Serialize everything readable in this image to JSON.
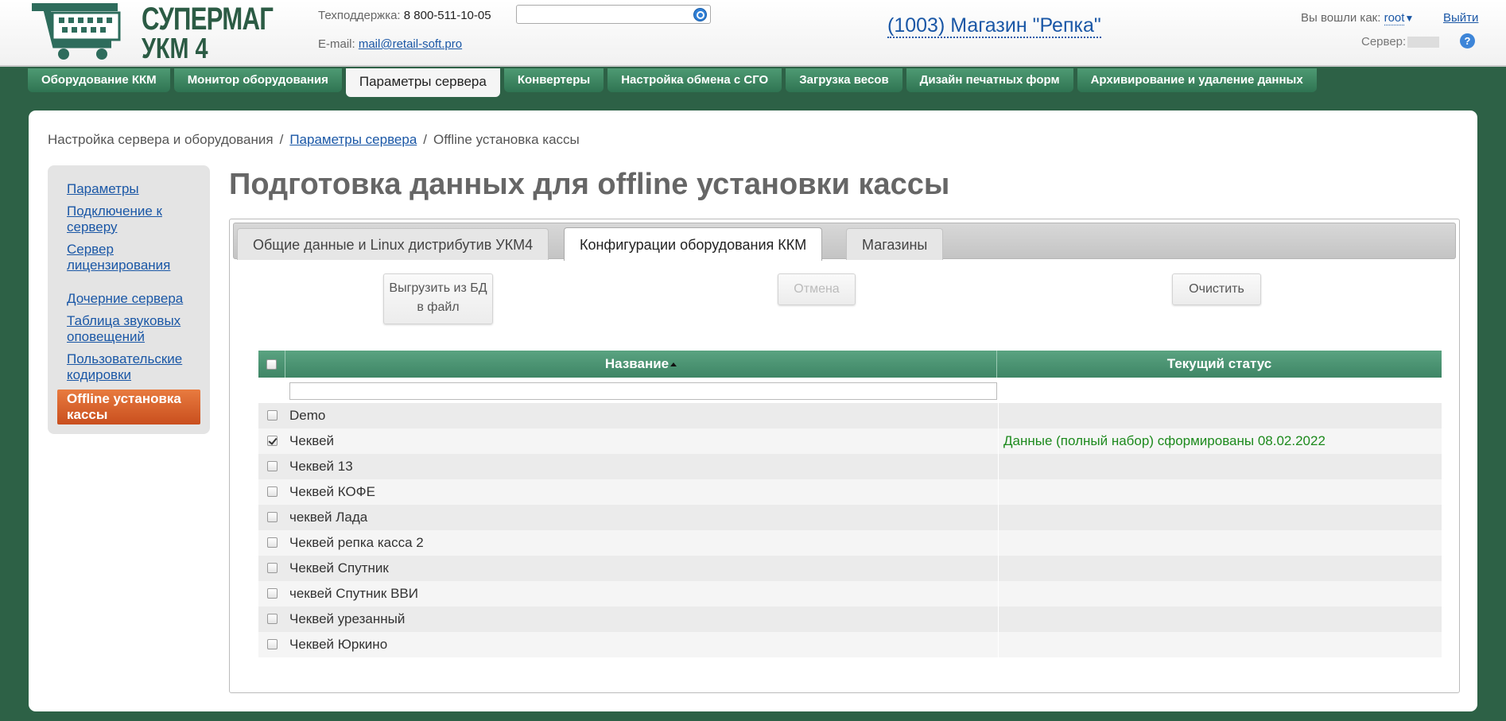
{
  "header": {
    "logo_line1": "СУПЕРМАГ",
    "logo_line2": "УКМ 4",
    "support_label": "Техподдержка:",
    "support_phone": "8 800-511-10-05",
    "email_label": "E-mail:",
    "email": "mail@retail-soft.pro",
    "search_placeholder": "",
    "store_name": "(1003) Магазин \"Репка\"",
    "login_label": "Вы вошли как:",
    "user": "root",
    "logout": "Выйти",
    "server_label": "Сервер:",
    "help": "?"
  },
  "nav": {
    "tabs": [
      {
        "label": "Оборудование ККМ"
      },
      {
        "label": "Монитор оборудования"
      },
      {
        "label": "Параметры сервера"
      },
      {
        "label": "Конвертеры"
      },
      {
        "label": "Настройка обмена с СГО"
      },
      {
        "label": "Загрузка весов"
      },
      {
        "label": "Дизайн печатных форм"
      },
      {
        "label": "Архивирование и удаление данных"
      }
    ],
    "active_index": 2
  },
  "breadcrumb": {
    "root": "Настройка сервера и оборудования",
    "parent": "Параметры сервера",
    "current": "Offline установка кассы",
    "sep": "/"
  },
  "sidebar": {
    "items": [
      {
        "label": "Параметры"
      },
      {
        "label": "Подключение к серверу"
      },
      {
        "label": "Сервер лицензирования"
      },
      {
        "label": "Дочерние сервера"
      },
      {
        "label": "Таблица звуковых оповещений"
      },
      {
        "label": "Пользовательские кодировки"
      },
      {
        "label": "Offline установка кассы"
      }
    ],
    "active_index": 6
  },
  "page_title": "Подготовка данных для offline установки кассы",
  "tabs": [
    {
      "label": "Общие данные и Linux дистрибутив УКМ4"
    },
    {
      "label": "Конфигурации оборудования ККМ"
    },
    {
      "label": "Магазины"
    }
  ],
  "buttons": {
    "export_line1": "Выгрузить из БД",
    "export_line2": "в файл",
    "cancel": "Отмена",
    "clear": "Очистить"
  },
  "grid": {
    "columns": [
      "Название",
      "Текущий статус"
    ],
    "filter_value": "",
    "rows": [
      {
        "name": "Demo",
        "status": "",
        "checked": false
      },
      {
        "name": "Чеквей",
        "status": "Данные (полный набор) сформированы 08.02.2022",
        "checked": true
      },
      {
        "name": "Чеквей 13",
        "status": "",
        "checked": false
      },
      {
        "name": "Чеквей КОФЕ",
        "status": "",
        "checked": false
      },
      {
        "name": "чеквей Лада",
        "status": "",
        "checked": false
      },
      {
        "name": "Чеквей репка касса 2",
        "status": "",
        "checked": false
      },
      {
        "name": "Чеквей Спутник",
        "status": "",
        "checked": false
      },
      {
        "name": "чеквей Спутник ВВИ",
        "status": "",
        "checked": false
      },
      {
        "name": "Чеквей урезанный",
        "status": "",
        "checked": false
      },
      {
        "name": "Чеквей Юркино",
        "status": "",
        "checked": false
      }
    ]
  },
  "colors": {
    "brand_green": "#2d6146",
    "nav_green": "#3e8565",
    "active_orange": "#d8602a",
    "link_blue": "#1a57a6",
    "status_green": "#1d8a1d"
  }
}
